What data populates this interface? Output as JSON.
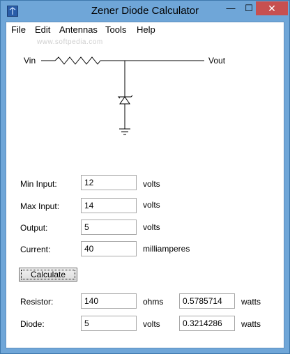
{
  "window": {
    "title": "Zener Diode Calculator",
    "minimize_glyph": "—",
    "maximize_glyph": "☐",
    "close_glyph": "✕"
  },
  "menu": [
    "File",
    "Edit",
    "Antennas",
    "Tools",
    "Help"
  ],
  "watermark": "www.softpedia.com",
  "circuit": {
    "vin_label": "Vin",
    "vout_label": "Vout"
  },
  "inputs": {
    "min_input": {
      "label": "Min Input:",
      "value": "12",
      "unit": "volts"
    },
    "max_input": {
      "label": "Max Input:",
      "value": "14",
      "unit": "volts"
    },
    "output": {
      "label": "Output:",
      "value": "5",
      "unit": "volts"
    },
    "current": {
      "label": "Current:",
      "value": "40",
      "unit": "milliamperes"
    }
  },
  "calculate_label": "Calculate",
  "results": {
    "resistor": {
      "label": "Resistor:",
      "value": "140",
      "unit": "ohms",
      "power": "0.5785714",
      "power_unit": "watts"
    },
    "diode": {
      "label": "Diode:",
      "value": "5",
      "unit": "volts",
      "power": "0.3214286",
      "power_unit": "watts"
    }
  },
  "colors": {
    "titlebar": "#6fa6d8",
    "close_button": "#c75050",
    "client_bg": "#ffffff"
  },
  "icons": [
    "app-icon",
    "resistor-icon",
    "zener-diode-icon",
    "ground-icon"
  ]
}
